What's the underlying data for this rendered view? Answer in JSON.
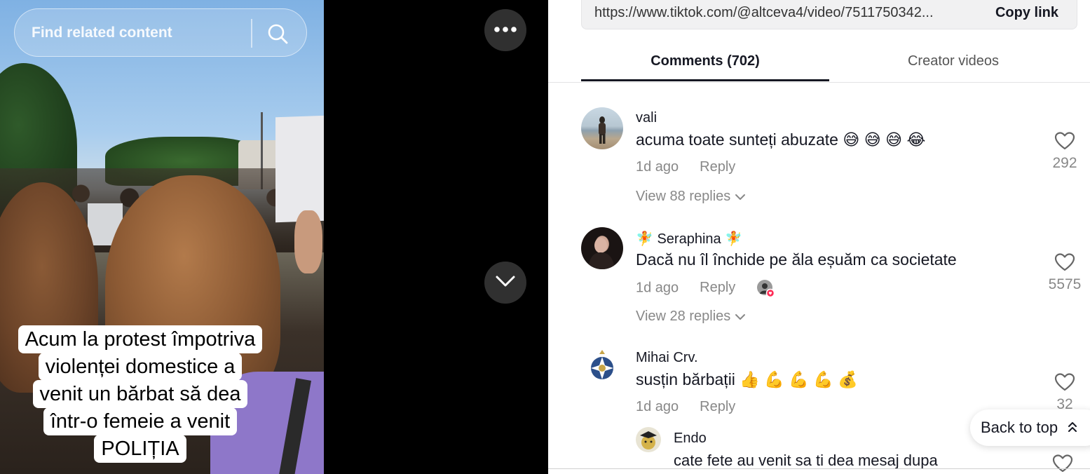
{
  "video": {
    "search_placeholder": "Find related content",
    "caption_lines": [
      "Acum la protest împotriva",
      "violenței domestice a",
      "venit un bărbat să dea",
      "într-o femeie a venit",
      "POLIȚIA"
    ]
  },
  "link": {
    "url": "https://www.tiktok.com/@altceva4/video/7511750342...",
    "copy_label": "Copy link"
  },
  "tabs": [
    {
      "label": "Comments (702)",
      "active": true
    },
    {
      "label": "Creator videos",
      "active": false
    }
  ],
  "comments": [
    {
      "user": "vali",
      "text": "acuma toate sunteți abuzate 😅 😅 😅 😂",
      "time": "1d ago",
      "reply_label": "Reply",
      "likes": "292",
      "view_replies": "View 88 replies"
    },
    {
      "user": "🧚 Seraphina 🧚",
      "text": "Dacă nu îl închide pe ăla eșuăm ca societate",
      "time": "1d ago",
      "reply_label": "Reply",
      "likes": "5575",
      "view_replies": "View 28 replies"
    },
    {
      "user": "Mihai Crv.",
      "text": "susțin bărbații 👍 💪 💪 💪 💰",
      "time": "1d ago",
      "reply_label": "Reply",
      "likes": "32"
    }
  ],
  "reply": {
    "user": "Endo",
    "text": "cate fete au venit sa ti dea mesaj dupa"
  },
  "back_to_top": "Back to top"
}
